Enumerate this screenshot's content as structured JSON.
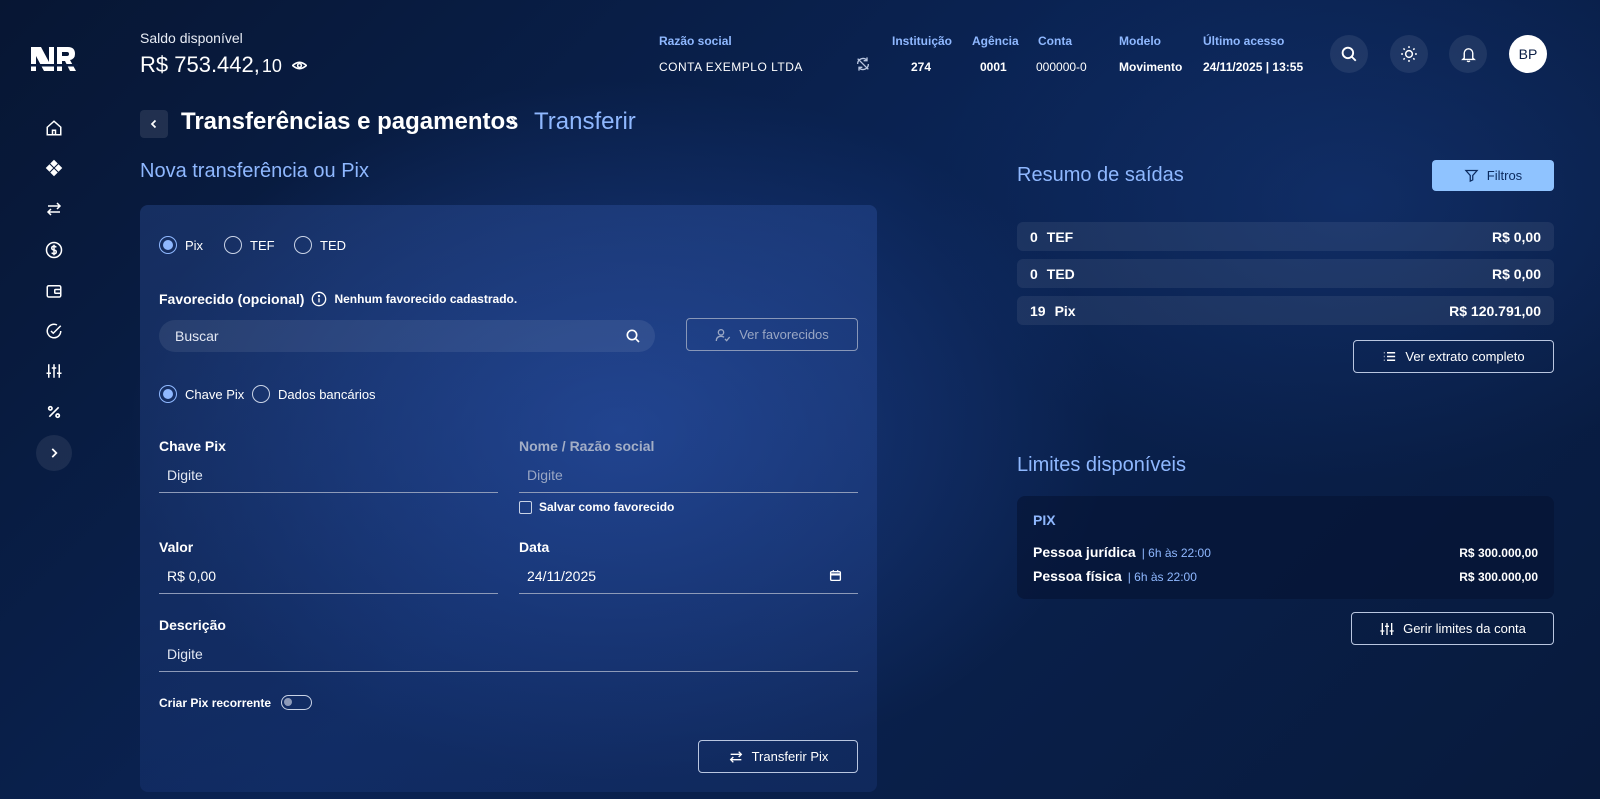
{
  "header": {
    "balance_label": "Saldo disponível",
    "balance_main": "R$ 753.442,",
    "balance_cents": "10",
    "razao_label": "Razão social",
    "razao_value": "CONTA EXEMPLO LTDA",
    "instituicao_label": "Instituição",
    "instituicao_value": "274",
    "agencia_label": "Agência",
    "agencia_value": "0001",
    "conta_label": "Conta",
    "conta_value": "000000-0",
    "modelo_label": "Modelo",
    "modelo_value": "Movimento",
    "acesso_label": "Último acesso",
    "acesso_value": "24/11/2025 | 13:55",
    "avatar_initials": "BP"
  },
  "breadcrumb": {
    "parent": "Transferências e pagamentos",
    "current": "Transferir"
  },
  "form": {
    "title": "Nova transferência ou Pix",
    "types": [
      {
        "label": "Pix",
        "selected": true
      },
      {
        "label": "TEF",
        "selected": false
      },
      {
        "label": "TED",
        "selected": false
      }
    ],
    "favorecido_label": "Favorecido (opcional)",
    "favorecido_note": "Nenhum favorecido cadastrado.",
    "search_placeholder": "Buscar",
    "ver_favorecidos": "Ver favorecidos",
    "key_modes": [
      {
        "label": "Chave Pix",
        "selected": true
      },
      {
        "label": "Dados bancários",
        "selected": false
      }
    ],
    "chave_label": "Chave Pix",
    "chave_placeholder": "Digite",
    "nome_label": "Nome / Razão social",
    "nome_placeholder": "Digite",
    "salvar_label": "Salvar como favorecido",
    "valor_label": "Valor",
    "valor_value": "R$ 0,00",
    "data_label": "Data",
    "data_value": "24/11/2025",
    "descricao_label": "Descrição",
    "descricao_placeholder": "Digite",
    "recorrente_label": "Criar Pix recorrente",
    "submit_label": "Transferir Pix"
  },
  "summary": {
    "title": "Resumo de saídas",
    "filter_label": "Filtros",
    "rows": [
      {
        "count": "0",
        "type": "TEF",
        "amount": "R$ 0,00"
      },
      {
        "count": "0",
        "type": "TED",
        "amount": "R$ 0,00"
      },
      {
        "count": "19",
        "type": "Pix",
        "amount": "R$ 120.791,00"
      }
    ],
    "extrato_label": "Ver extrato completo"
  },
  "limits": {
    "title": "Limites disponíveis",
    "category": "PIX",
    "rows": [
      {
        "name": "Pessoa jurídica",
        "hours": "| 6h às 22:00",
        "amount": "R$ 300.000,00"
      },
      {
        "name": "Pessoa física",
        "hours": "| 6h às 22:00",
        "amount": "R$ 300.000,00"
      }
    ],
    "manage_label": "Gerir limites da conta"
  },
  "colors": {
    "accent": "#8fb8ff",
    "button_primary": "#8fc3ff",
    "background": "#0a2353"
  }
}
